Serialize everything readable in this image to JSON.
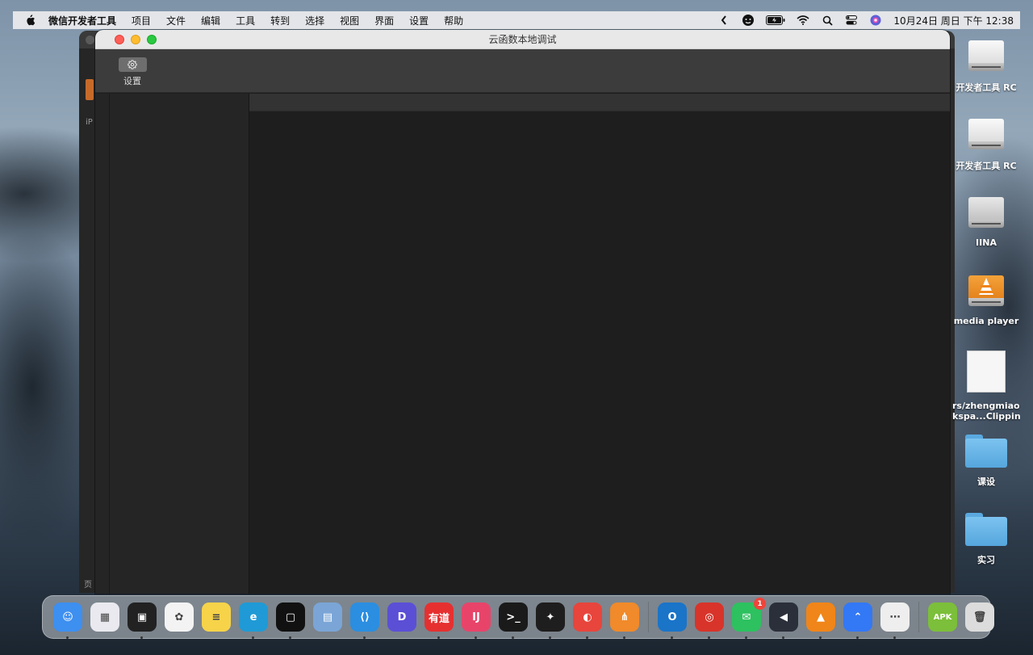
{
  "menubar": {
    "app_name": "微信开发者工具",
    "items": [
      "项目",
      "文件",
      "编辑",
      "工具",
      "转到",
      "选择",
      "视图",
      "界面",
      "设置",
      "帮助"
    ],
    "clock": "10月24日 周日 下午 12:38"
  },
  "background_window": {
    "side_label": "iP",
    "bottom_label": "页"
  },
  "window": {
    "title": "云函数本地调试",
    "toolbar": {
      "settings_label": "设置",
      "settings_icon": "gear-icon"
    }
  },
  "desktop": {
    "icons": [
      {
        "label": "开发者工具 RC",
        "kind": "disk"
      },
      {
        "label": "开发者工具 RC",
        "kind": "disk"
      },
      {
        "label": "IINA",
        "kind": "disk"
      },
      {
        "label": "media player",
        "kind": "vlc-disk"
      },
      {
        "label": "rs/zhengmiao/",
        "label2": "kspa...Clipping",
        "kind": "document"
      },
      {
        "label": "课设",
        "kind": "folder"
      },
      {
        "label": "实习",
        "kind": "folder"
      }
    ]
  },
  "dock": {
    "apps": [
      {
        "name": "finder",
        "color": "#3d8ff0",
        "glyph": "☺",
        "running": true
      },
      {
        "name": "launchpad",
        "color": "#e9e9ef",
        "glyph": "▦",
        "running": false
      },
      {
        "name": "mission-control",
        "color": "#222222",
        "glyph": "▣",
        "running": true
      },
      {
        "name": "photos",
        "color": "#f3f3f3",
        "glyph": "✿",
        "running": false
      },
      {
        "name": "notes",
        "color": "#f7d34a",
        "glyph": "≡",
        "running": false
      },
      {
        "name": "edge",
        "color": "#1f9ad6",
        "glyph": "e",
        "running": true
      },
      {
        "name": "screenshot",
        "color": "#111111",
        "glyph": "▢",
        "running": true
      },
      {
        "name": "preview",
        "color": "#7aa5d6",
        "glyph": "▤",
        "running": false
      },
      {
        "name": "vscode",
        "color": "#2b8ee0",
        "glyph": "⟨⟩",
        "running": true
      },
      {
        "name": "dingtalk",
        "color": "#5b4fd6",
        "glyph": "D",
        "running": false
      },
      {
        "name": "youdao",
        "color": "#e63030",
        "glyph": "有道",
        "running": true
      },
      {
        "name": "intellij",
        "color": "#e8446a",
        "glyph": "IJ",
        "running": true
      },
      {
        "name": "terminal",
        "color": "#1a1a1a",
        "glyph": ">_",
        "running": true
      },
      {
        "name": "figma",
        "color": "#1e1e1e",
        "glyph": "✦",
        "running": true
      },
      {
        "name": "netease-music-alt",
        "color": "#e8453c",
        "glyph": "◐",
        "running": true
      },
      {
        "name": "xmind",
        "color": "#f08a2a",
        "glyph": "⋔",
        "running": true
      },
      {
        "name": "outlook",
        "color": "#1a74c8",
        "glyph": "O",
        "running": true
      },
      {
        "name": "netease-music",
        "color": "#d8342a",
        "glyph": "◎",
        "running": true
      },
      {
        "name": "wechat",
        "color": "#2dc160",
        "glyph": "✉",
        "running": true,
        "badge": "1"
      },
      {
        "name": "infuse",
        "color": "#2a2f3a",
        "glyph": "◀",
        "running": true
      },
      {
        "name": "vlc",
        "color": "#f08519",
        "glyph": "▲",
        "running": true
      },
      {
        "name": "lark",
        "color": "#3378f5",
        "glyph": "⌃",
        "running": true
      },
      {
        "name": "wechat-devtools",
        "color": "#eeeeee",
        "glyph": "⋯",
        "running": true
      },
      {
        "name": "apk-installer",
        "color": "#7cbf3a",
        "glyph": "APK",
        "running": false
      },
      {
        "name": "trash",
        "color": "#dcdcdc",
        "glyph": "🗑",
        "running": false
      }
    ]
  }
}
